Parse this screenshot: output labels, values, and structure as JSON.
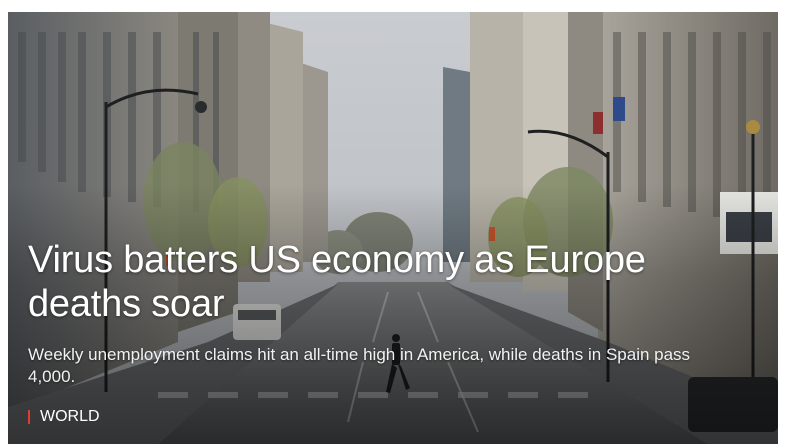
{
  "article": {
    "headline": "Virus batters US economy as Europe deaths soar",
    "summary": "Weekly unemployment claims hit an all-time high in America, while deaths in Spain pass 4,000.",
    "section": "WORLD",
    "image_description_icon": "photo-empty-city-street"
  },
  "colors": {
    "section_marker": "#e03c31",
    "text": "#ffffff"
  }
}
